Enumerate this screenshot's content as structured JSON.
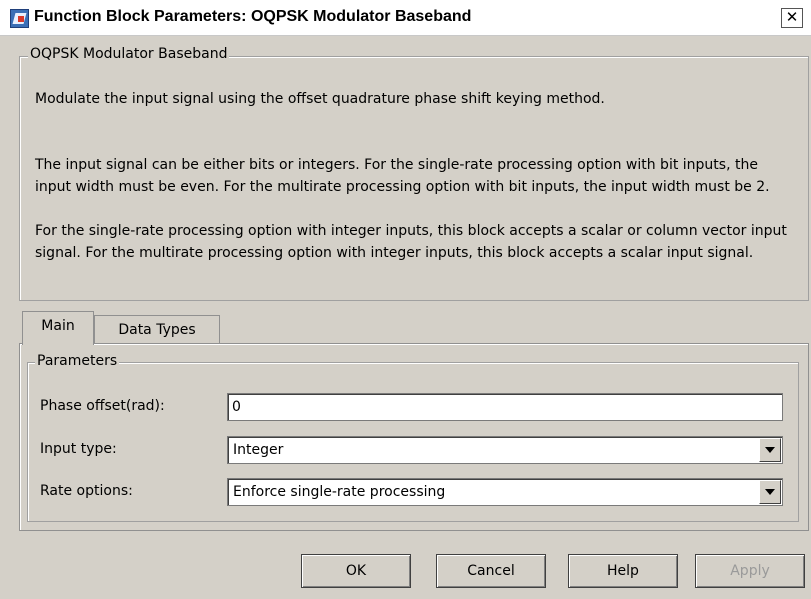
{
  "window": {
    "title": "Function Block Parameters: OQPSK Modulator Baseband",
    "close_glyph": "✕"
  },
  "block": {
    "legend": "OQPSK Modulator Baseband",
    "paragraphs": [
      "Modulate the input signal using the offset quadrature phase shift keying method.",
      "The input signal can be either bits or integers. For the single-rate processing option with bit inputs, the input width must be even. For the multirate processing option with bit inputs, the input width must be 2.",
      "For the single-rate processing option with integer inputs, this block accepts a scalar or column vector input signal. For the multirate processing option with integer inputs, this block accepts a scalar input signal."
    ]
  },
  "tabs": [
    {
      "label": "Main",
      "active": true
    },
    {
      "label": "Data Types",
      "active": false
    }
  ],
  "parameters": {
    "legend": "Parameters",
    "phase_offset_label": "Phase offset(rad):",
    "phase_offset_value": "0",
    "input_type_label": "Input type:",
    "input_type_value": "Integer",
    "rate_options_label": "Rate options:",
    "rate_options_value": "Enforce single-rate processing"
  },
  "buttons": {
    "ok": "OK",
    "cancel": "Cancel",
    "help": "Help",
    "apply": "Apply"
  }
}
